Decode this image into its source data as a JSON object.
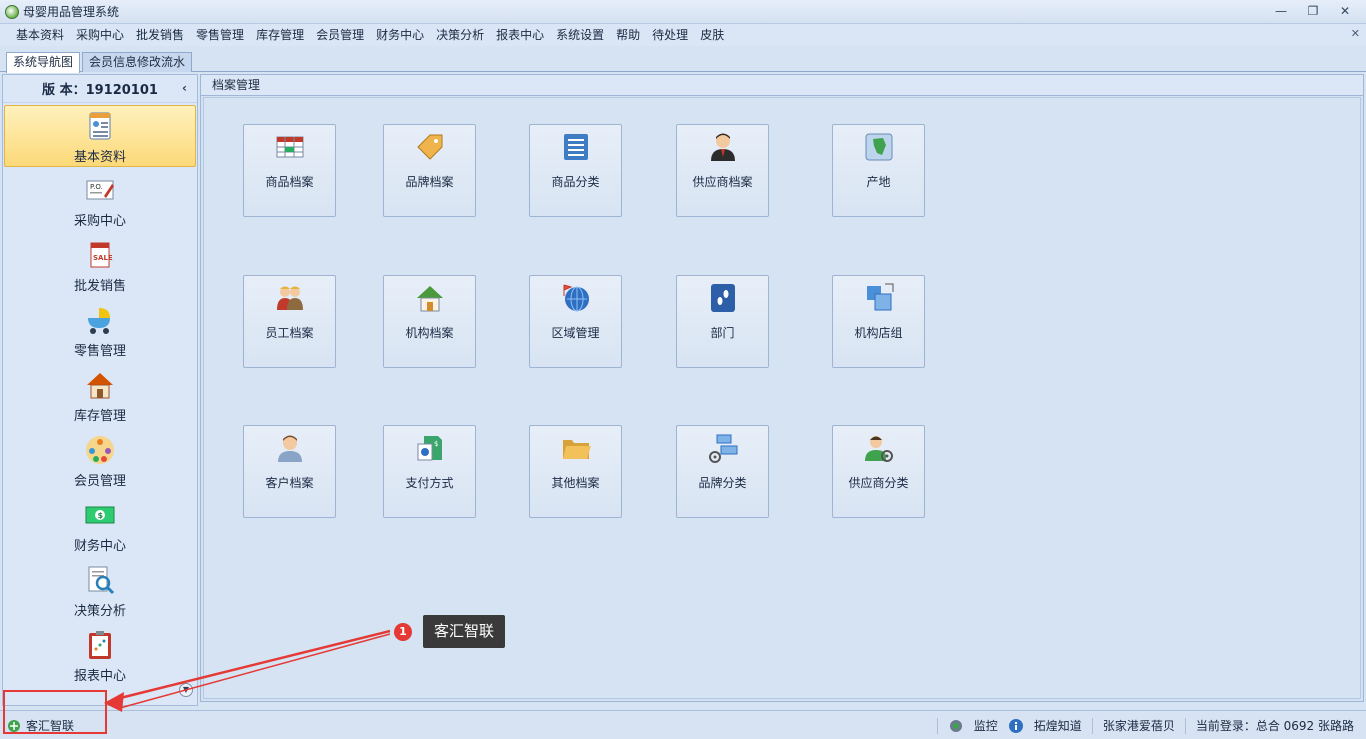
{
  "window": {
    "title": "母婴用品管理系统"
  },
  "menu": [
    {
      "label": "基本资料"
    },
    {
      "label": "采购中心"
    },
    {
      "label": "批发销售"
    },
    {
      "label": "零售管理"
    },
    {
      "label": "库存管理"
    },
    {
      "label": "会员管理"
    },
    {
      "label": "财务中心"
    },
    {
      "label": "决策分析"
    },
    {
      "label": "报表中心"
    },
    {
      "label": "系统设置"
    },
    {
      "label": "帮助"
    },
    {
      "label": "待处理"
    },
    {
      "label": "皮肤"
    }
  ],
  "tabs": [
    {
      "label": "系统导航图",
      "active": true
    },
    {
      "label": "会员信息修改流水",
      "active": false
    }
  ],
  "sidebar": {
    "version": "版 本：19120101",
    "items": [
      {
        "label": "基本资料",
        "icon": "profile-card-icon",
        "selected": true
      },
      {
        "label": "采购中心",
        "icon": "purchase-order-icon",
        "selected": false
      },
      {
        "label": "批发销售",
        "icon": "sale-tag-icon",
        "selected": false
      },
      {
        "label": "零售管理",
        "icon": "stroller-icon",
        "selected": false
      },
      {
        "label": "库存管理",
        "icon": "house-icon",
        "selected": false
      },
      {
        "label": "会员管理",
        "icon": "members-icon",
        "selected": false
      },
      {
        "label": "财务中心",
        "icon": "banknote-icon",
        "selected": false
      },
      {
        "label": "决策分析",
        "icon": "magnifier-report-icon",
        "selected": false
      },
      {
        "label": "报表中心",
        "icon": "clipboard-chart-icon",
        "selected": false
      }
    ]
  },
  "main": {
    "section_title": "档案管理",
    "tiles": [
      {
        "label": "商品档案",
        "icon": "table-grid-icon"
      },
      {
        "label": "品牌档案",
        "icon": "tag-icon"
      },
      {
        "label": "商品分类",
        "icon": "list-icon"
      },
      {
        "label": "供应商档案",
        "icon": "businessman-icon"
      },
      {
        "label": "产地",
        "icon": "map-icon"
      },
      {
        "label": "员工档案",
        "icon": "staff-icon"
      },
      {
        "label": "机构档案",
        "icon": "home-icon"
      },
      {
        "label": "区域管理",
        "icon": "globe-flag-icon"
      },
      {
        "label": "部门",
        "icon": "footprint-icon"
      },
      {
        "label": "机构店组",
        "icon": "group-squares-icon"
      },
      {
        "label": "客户档案",
        "icon": "customer-icon"
      },
      {
        "label": "支付方式",
        "icon": "payment-icon"
      },
      {
        "label": "其他档案",
        "icon": "folder-icon"
      },
      {
        "label": "品牌分类",
        "icon": "brand-category-icon"
      },
      {
        "label": "供应商分类",
        "icon": "supplier-category-icon"
      }
    ]
  },
  "status": {
    "left": "客汇智联",
    "monitor": "监控",
    "info": "拓煌知道",
    "store": "张家港爱蓓贝",
    "login": "当前登录：总合 0692 张路路"
  },
  "annotation": {
    "number": "1",
    "text": "客汇智联"
  },
  "colors": {
    "selected_bg": "#fcd978",
    "annotation": "#e53935"
  }
}
